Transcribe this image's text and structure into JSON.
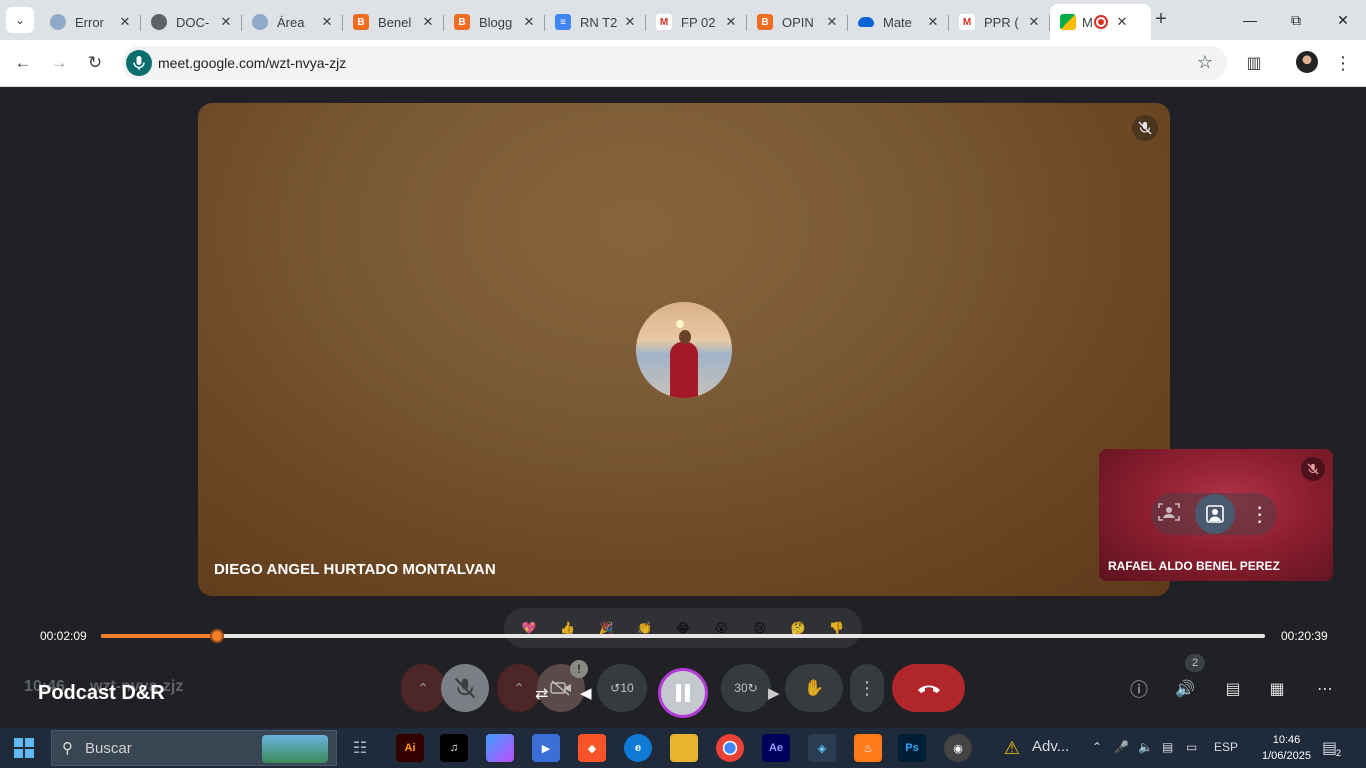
{
  "browser": {
    "tabs": [
      {
        "title": "Error",
        "favicon": "globe-icon"
      },
      {
        "title": "DOC-",
        "favicon": "globe-icon"
      },
      {
        "title": "Área",
        "favicon": "globe-icon"
      },
      {
        "title": "Benel",
        "favicon": "blogger-icon"
      },
      {
        "title": "Blogg",
        "favicon": "blogger-icon"
      },
      {
        "title": "RN T2",
        "favicon": "docs-icon"
      },
      {
        "title": "FP 02",
        "favicon": "gmail-icon"
      },
      {
        "title": "OPIN",
        "favicon": "blogger-icon"
      },
      {
        "title": "Mate",
        "favicon": "onedrive-icon"
      },
      {
        "title": "PPR (",
        "favicon": "gmail-icon"
      },
      {
        "title": "M",
        "favicon": "meet-icon"
      }
    ],
    "url": "meet.google.com/wzt-nvya-zjz"
  },
  "meet": {
    "main_participant": "DIEGO ANGEL HURTADO MONTALVAN",
    "side_participant": "RAFAEL ALDO BENEL PEREZ",
    "reactions": [
      "💖",
      "👍",
      "🎉",
      "👏",
      "😂",
      "😮",
      "😢",
      "🤔",
      "👎"
    ],
    "participant_count": "2",
    "meeting_code_ghost": "wzt-nvya-zjz",
    "clock_ghost": "10:46"
  },
  "player": {
    "title": "Podcast D&R",
    "current_time": "00:02:09",
    "total_time": "00:20:39",
    "progress": 0.1
  },
  "taskbar": {
    "search_label": "Buscar",
    "adv_label": "Adv...",
    "language": "ESP",
    "time": "10:46",
    "date": "1/06/2025",
    "notifications": "2"
  },
  "colors": {
    "accent_orange": "#f07f2c",
    "leave_red": "#b0262a"
  }
}
